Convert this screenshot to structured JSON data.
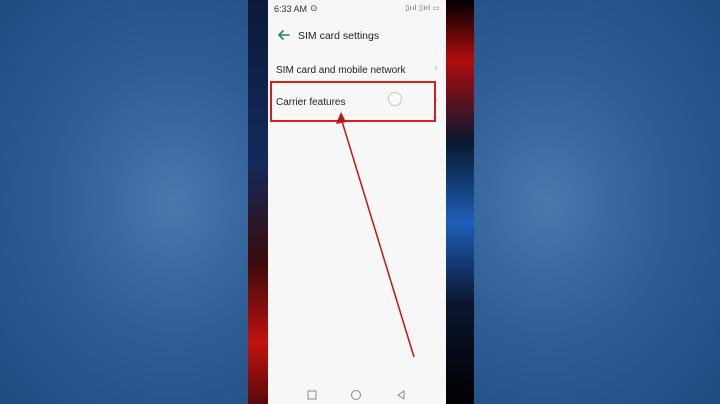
{
  "status_bar": {
    "time": "6:33 AM",
    "location_icon": "location-icon",
    "indicators": "▯ııl ▯ııl ▭"
  },
  "header": {
    "back_icon": "back-arrow-icon",
    "title": "SIM card settings"
  },
  "rows": [
    {
      "label": "SIM card and mobile network",
      "icon": "chevron-right-icon"
    },
    {
      "label": "Carrier features",
      "icon": "chevron-right-icon",
      "loading": true
    }
  ],
  "chevron": "›",
  "nav_bar": {
    "items": [
      "recents-button",
      "home-button",
      "back-button"
    ]
  },
  "colors": {
    "highlight": "#d91c1c",
    "accent": "#1a8a5a",
    "arrow": "#c01515"
  }
}
